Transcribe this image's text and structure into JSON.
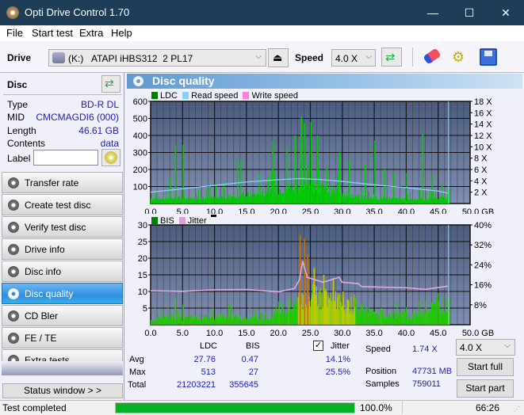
{
  "window": {
    "title": "Opti Drive Control 1.70",
    "minimize": "—",
    "maximize": "☐",
    "close": "✕"
  },
  "menu": [
    "File",
    "Start test",
    "Extra",
    "Help"
  ],
  "toolbar": {
    "drive_label": "Drive",
    "drive_letter": "(K:)",
    "drive_name": "ATAPI iHBS312  2 PL17",
    "speed_label": "Speed",
    "speed_value": "4.0 X"
  },
  "disc": {
    "header": "Disc",
    "rows": [
      {
        "label": "Type",
        "value": "BD-R DL"
      },
      {
        "label": "MID",
        "value": "CMCMAGDI6 (000)"
      },
      {
        "label": "Length",
        "value": "46.61 GB"
      },
      {
        "label": "Contents",
        "value": "data"
      }
    ],
    "label_field_label": "Label",
    "label_field_value": ""
  },
  "nav": [
    {
      "label": "Transfer rate",
      "active": false
    },
    {
      "label": "Create test disc",
      "active": false
    },
    {
      "label": "Verify test disc",
      "active": false
    },
    {
      "label": "Drive info",
      "active": false
    },
    {
      "label": "Disc info",
      "active": false
    },
    {
      "label": "Disc quality",
      "active": true
    },
    {
      "label": "CD Bler",
      "active": false
    },
    {
      "label": "FE / TE",
      "active": false
    },
    {
      "label": "Extra tests",
      "active": false
    }
  ],
  "status_window_button": "Status window > >",
  "panel_title": "Disc quality",
  "colors": {
    "ldc": "#00c000",
    "read_speed": "#87cefa",
    "write_speed": "#ff80e0",
    "bis": "#00a000",
    "jitter": "#d8a0d8",
    "progress": "#06b025"
  },
  "chart_data": [
    {
      "type": "bar",
      "title": "LDC / Read speed",
      "legend": [
        "LDC",
        "Read speed",
        "Write speed"
      ],
      "xlabel": "GB",
      "x_ticks": [
        "0.0",
        "5.0",
        "10.0",
        "15.0",
        "20.0",
        "25.0",
        "30.0",
        "35.0",
        "40.0",
        "45.0",
        "50.0 GB"
      ],
      "xlim": [
        0,
        50
      ],
      "y_ticks": [
        "600",
        "500",
        "400",
        "300",
        "200",
        "100"
      ],
      "ylim": [
        0,
        600
      ],
      "y2_ticks": [
        "18 X",
        "16 X",
        "14 X",
        "12 X",
        "10 X",
        "8 X",
        "6 X",
        "4 X",
        "2 X"
      ],
      "y2lim": [
        0,
        18
      ],
      "grid": true,
      "ldc_peaks": [
        [
          3.8,
          340
        ],
        [
          5.0,
          345
        ],
        [
          3.0,
          150
        ],
        [
          9.2,
          110
        ],
        [
          13.5,
          260
        ],
        [
          14.0,
          260
        ],
        [
          19.0,
          370
        ],
        [
          21.2,
          330
        ],
        [
          22.5,
          400
        ],
        [
          23.5,
          510
        ],
        [
          24.0,
          470
        ],
        [
          25.0,
          480
        ],
        [
          26.0,
          400
        ],
        [
          27.5,
          210
        ],
        [
          29.5,
          300
        ],
        [
          31.0,
          260
        ],
        [
          33.5,
          230
        ],
        [
          35.0,
          370
        ],
        [
          36.5,
          200
        ],
        [
          38.0,
          180
        ],
        [
          40.0,
          180
        ],
        [
          42.5,
          410
        ],
        [
          44.0,
          170
        ],
        [
          45.5,
          120
        ],
        [
          46.6,
          95
        ]
      ],
      "ldc_baseline": [
        [
          0,
          30
        ],
        [
          10,
          35
        ],
        [
          18,
          60
        ],
        [
          22,
          100
        ],
        [
          25,
          100
        ],
        [
          28,
          80
        ],
        [
          32,
          40
        ],
        [
          40,
          25
        ],
        [
          46.6,
          30
        ]
      ],
      "read_speed": [
        [
          0,
          2.0
        ],
        [
          5,
          2.6
        ],
        [
          10,
          3.2
        ],
        [
          15,
          3.8
        ],
        [
          20,
          4.2
        ],
        [
          23.5,
          4.4
        ],
        [
          27,
          4.2
        ],
        [
          30,
          3.9
        ],
        [
          35,
          3.3
        ],
        [
          40,
          2.8
        ],
        [
          45,
          2.2
        ],
        [
          46.6,
          1.8
        ]
      ],
      "end_marker_gb": 46.61
    },
    {
      "type": "bar",
      "title": "BIS / Jitter",
      "legend": [
        "BIS",
        "Jitter"
      ],
      "xlabel": "GB",
      "x_ticks": [
        "0.0",
        "5.0",
        "10.0",
        "15.0",
        "20.0",
        "25.0",
        "30.0",
        "35.0",
        "40.0",
        "45.0",
        "50.0 GB"
      ],
      "xlim": [
        0,
        50
      ],
      "y_ticks": [
        "30",
        "25",
        "20",
        "15",
        "10",
        "5"
      ],
      "ylim": [
        0,
        30
      ],
      "y2_ticks": [
        "40%",
        "32%",
        "24%",
        "16%",
        "8%"
      ],
      "y2lim": [
        0,
        40
      ],
      "grid": true,
      "bis_peaks": [
        [
          3.8,
          8
        ],
        [
          5.0,
          6
        ],
        [
          20.0,
          7
        ],
        [
          21.5,
          8
        ],
        [
          23.3,
          27
        ],
        [
          24.0,
          26
        ],
        [
          24.5,
          21
        ],
        [
          25.5,
          17
        ],
        [
          27.0,
          15
        ],
        [
          28.5,
          14
        ],
        [
          30.0,
          10
        ],
        [
          32.0,
          8
        ],
        [
          36.0,
          5
        ],
        [
          43.0,
          7
        ],
        [
          46.6,
          8
        ]
      ],
      "bis_baseline": [
        [
          0,
          2
        ],
        [
          19,
          2.5
        ],
        [
          22,
          5
        ],
        [
          25,
          9
        ],
        [
          29,
          7
        ],
        [
          32.5,
          5
        ],
        [
          35,
          3
        ],
        [
          42,
          3
        ],
        [
          44,
          5
        ],
        [
          46.6,
          6
        ]
      ],
      "jitter_pct": [
        [
          0,
          13.6
        ],
        [
          5,
          13.4
        ],
        [
          10,
          14.0
        ],
        [
          15,
          14.1
        ],
        [
          20,
          13.2
        ],
        [
          22.5,
          14.5
        ],
        [
          23.3,
          18
        ],
        [
          23.8,
          25.5
        ],
        [
          24.5,
          19
        ],
        [
          27,
          17
        ],
        [
          29.5,
          19
        ],
        [
          30,
          17
        ],
        [
          32.5,
          16.5
        ],
        [
          33,
          15.3
        ],
        [
          40,
          14.8
        ],
        [
          43,
          14.2
        ],
        [
          46.6,
          15.5
        ]
      ],
      "end_marker_gb": 46.61
    }
  ],
  "stats": {
    "col_ldc": "LDC",
    "col_bis": "BIS",
    "jitter_label": "Jitter",
    "jitter_checked": true,
    "rows": [
      {
        "label": "Avg",
        "ldc": "27.76",
        "bis": "0.47",
        "jitter": "14.1%"
      },
      {
        "label": "Max",
        "ldc": "513",
        "bis": "27",
        "jitter": "25.5%"
      },
      {
        "label": "Total",
        "ldc": "21203221",
        "bis": "355645",
        "jitter": ""
      }
    ],
    "speed_label": "Speed",
    "speed_value": "1.74 X",
    "position_label": "Position",
    "position_value": "47731 MB",
    "samples_label": "Samples",
    "samples_value": "759011",
    "speed_select": "4.0 X",
    "start_full": "Start full",
    "start_part": "Start part"
  },
  "status": {
    "text": "Test completed",
    "progress_pct": 100.0,
    "progress_text": "100.0%",
    "elapsed": "66:26"
  }
}
